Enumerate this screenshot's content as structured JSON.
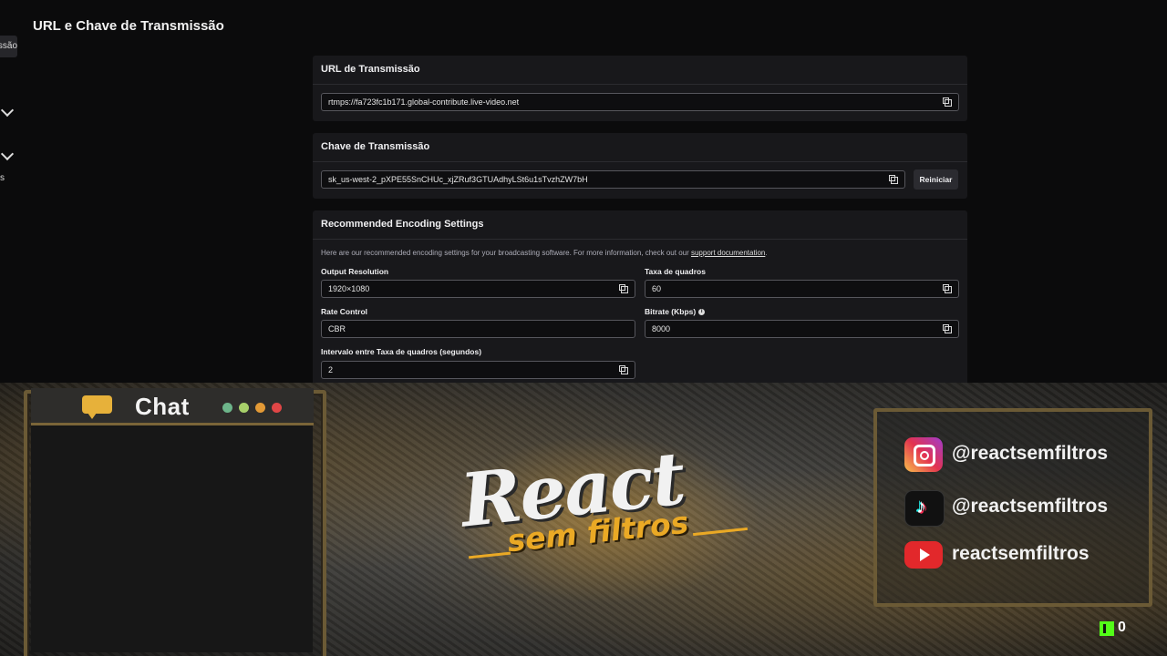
{
  "page": {
    "title": "URL e Chave de Transmissão",
    "sidebar_active_fragment": "nissão",
    "sidebar_fragment_s": "s"
  },
  "url_card": {
    "title": "URL de Transmissão",
    "value": "rtmps://fa723fc1b171.global-contribute.live-video.net"
  },
  "key_card": {
    "title": "Chave de Transmissão",
    "value": "sk_us-west-2_pXPE55SnCHUc_xjZRuf3GTUAdhyLSt6u1sTvzhZW7bH",
    "reset_label": "Reiniciar"
  },
  "encoding_card": {
    "title": "Recommended Encoding Settings",
    "description": "Here are our recommended encoding settings for your broadcasting software. For more information, check out our ",
    "link_text": "support documentation",
    "description_end": ".",
    "fields": {
      "output_resolution": {
        "label": "Output Resolution",
        "value": "1920×1080"
      },
      "frame_rate": {
        "label": "Taxa de quadros",
        "value": "60"
      },
      "rate_control": {
        "label": "Rate Control",
        "value": "CBR"
      },
      "bitrate": {
        "label": "Bitrate (Kbps)",
        "value": "8000"
      },
      "keyframe_interval": {
        "label": "Intervalo entre Taxa de quadros (segundos)",
        "value": "2"
      }
    }
  },
  "overlay": {
    "chat_title": "Chat",
    "logo_main": "React",
    "logo_sub": "sem filtros",
    "socials": [
      {
        "icon": "instagram-icon",
        "handle": "@reactsemfiltros"
      },
      {
        "icon": "tiktok-icon",
        "handle": "@reactsemfiltros"
      },
      {
        "icon": "youtube-icon",
        "handle": "reactsemfiltros"
      }
    ],
    "kick_count": "0",
    "colors": {
      "accent": "#eaa925",
      "frame": "#6b5a35"
    }
  }
}
